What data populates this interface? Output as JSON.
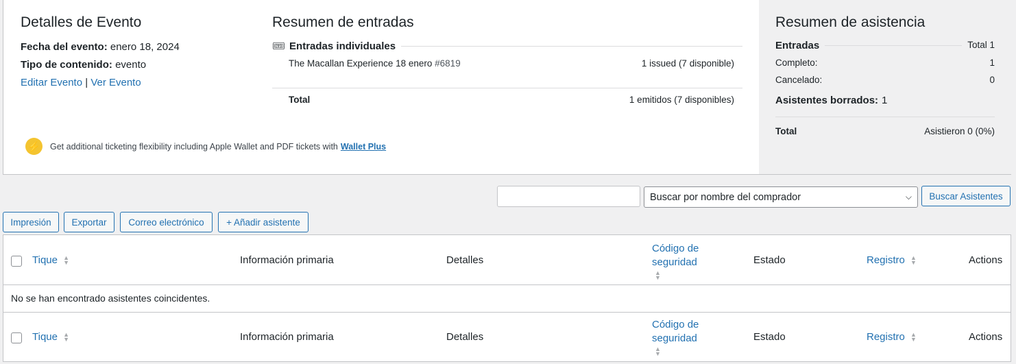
{
  "event": {
    "heading": "Detalles de Evento",
    "date_label": "Fecha del evento:",
    "date_value": "enero 18, 2024",
    "type_label": "Tipo de contenido:",
    "type_value": "evento",
    "edit_link": "Editar Evento",
    "separator": "|",
    "view_link": "Ver Evento"
  },
  "promo": {
    "text": "Get additional ticketing flexibility including Apple Wallet and PDF tickets with",
    "link": "Wallet Plus",
    "icon": "lightning-icon"
  },
  "tickets": {
    "heading": "Resumen de entradas",
    "subheading": "Entradas individuales",
    "items": [
      {
        "name": "The Macallan Experience 18 enero",
        "id": "#6819",
        "status": "1 issued (7 disponible)"
      }
    ],
    "total_label": "Total",
    "total_value": "1 emitidos (7 disponibles)"
  },
  "attendance": {
    "heading": "Resumen de asistencia",
    "entries_label": "Entradas",
    "entries_total": "Total 1",
    "complete_label": "Completo:",
    "complete_value": "1",
    "cancelled_label": "Cancelado:",
    "cancelled_value": "0",
    "deleted_label": "Asistentes borrados:",
    "deleted_value": "1",
    "total_label": "Total",
    "total_value": "Asistieron 0 (0%)"
  },
  "toolbar": {
    "search_value": "",
    "filter_selected": "Buscar por nombre del comprador",
    "search_button": "Buscar Asistentes",
    "print_button": "Impresión",
    "export_button": "Exportar",
    "email_button": "Correo electrónico",
    "add_button": "+ Añadir asistente"
  },
  "table": {
    "columns": {
      "ticket": "Tique",
      "primary_info": "Información primaria",
      "details": "Detalles",
      "security_code_1": "Código de",
      "security_code_2": "seguridad",
      "status": "Estado",
      "checkin": "Registro",
      "actions": "Actions"
    },
    "empty_message": "No se han encontrado asistentes coincidentes."
  },
  "colors": {
    "link": "#2271b1",
    "bolt": "#f4c430",
    "panel_bg": "#f0f0f1"
  }
}
